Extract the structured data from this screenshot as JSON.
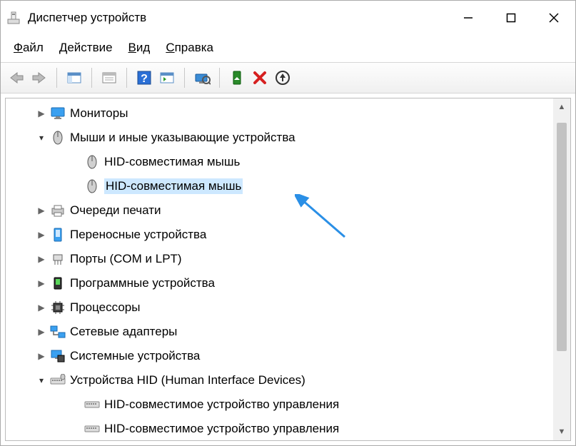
{
  "title": "Диспетчер устройств",
  "menu": {
    "file": "Файл",
    "action": "Действие",
    "view": "Вид",
    "help": "Справка"
  },
  "tree": {
    "monitors": "Мониторы",
    "mice": "Мыши и иные указывающие устройства",
    "hid_mouse_1": "HID-совместимая мышь",
    "hid_mouse_2": "HID-совместимая мышь",
    "print_queues": "Очереди печати",
    "portable": "Переносные устройства",
    "ports": "Порты (COM и LPT)",
    "software": "Программные устройства",
    "processors": "Процессоры",
    "network": "Сетевые адаптеры",
    "system": "Системные устройства",
    "hid": "Устройства HID (Human Interface Devices)",
    "hid_compat_1": "HID-совместимое устройство управления",
    "hid_compat_2": "HID-совместимое устройство управления"
  }
}
